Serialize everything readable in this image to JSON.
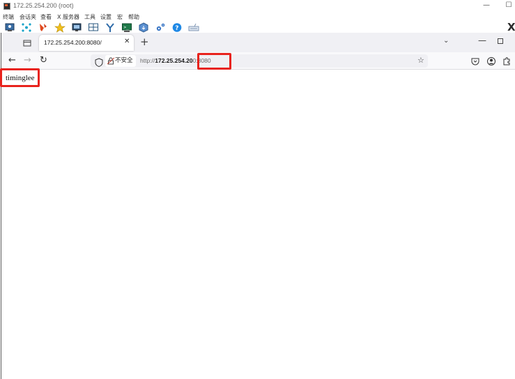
{
  "outer_window": {
    "title": "172.25.254.200 (root)",
    "menu": [
      "终端",
      "会话夹",
      "查看",
      "X 服务器",
      "工具",
      "设置",
      "宏",
      "帮助"
    ],
    "toolbar_icons": [
      "session-icon",
      "xserver-icon",
      "tools-icon",
      "star-icon",
      "monitor-icon",
      "split-icon",
      "network-icon",
      "terminal-icon",
      "package-icon",
      "settings-icon",
      "help-icon",
      "keyboard-icon"
    ],
    "minimize": "—",
    "maximize": "☐",
    "corner_icon": "X"
  },
  "browser": {
    "tab": {
      "title": "172.25.254.200:8080/",
      "close": "✕"
    },
    "new_tab": "+",
    "list_all": "⌄",
    "minimize": "—",
    "nav": {
      "back": "←",
      "forward": "→",
      "reload": "↻"
    },
    "urlbar": {
      "insecure_label": "不安全",
      "url_scheme": "http://",
      "url_host": "172.25.254.20",
      "url_rest": "0:8080"
    },
    "star": "☆"
  },
  "page": {
    "text": "timinglee"
  },
  "colors": {
    "highlight": "#e8231d",
    "tabbar": "#f0f0f4",
    "urlbar": "#f0f0f4"
  }
}
